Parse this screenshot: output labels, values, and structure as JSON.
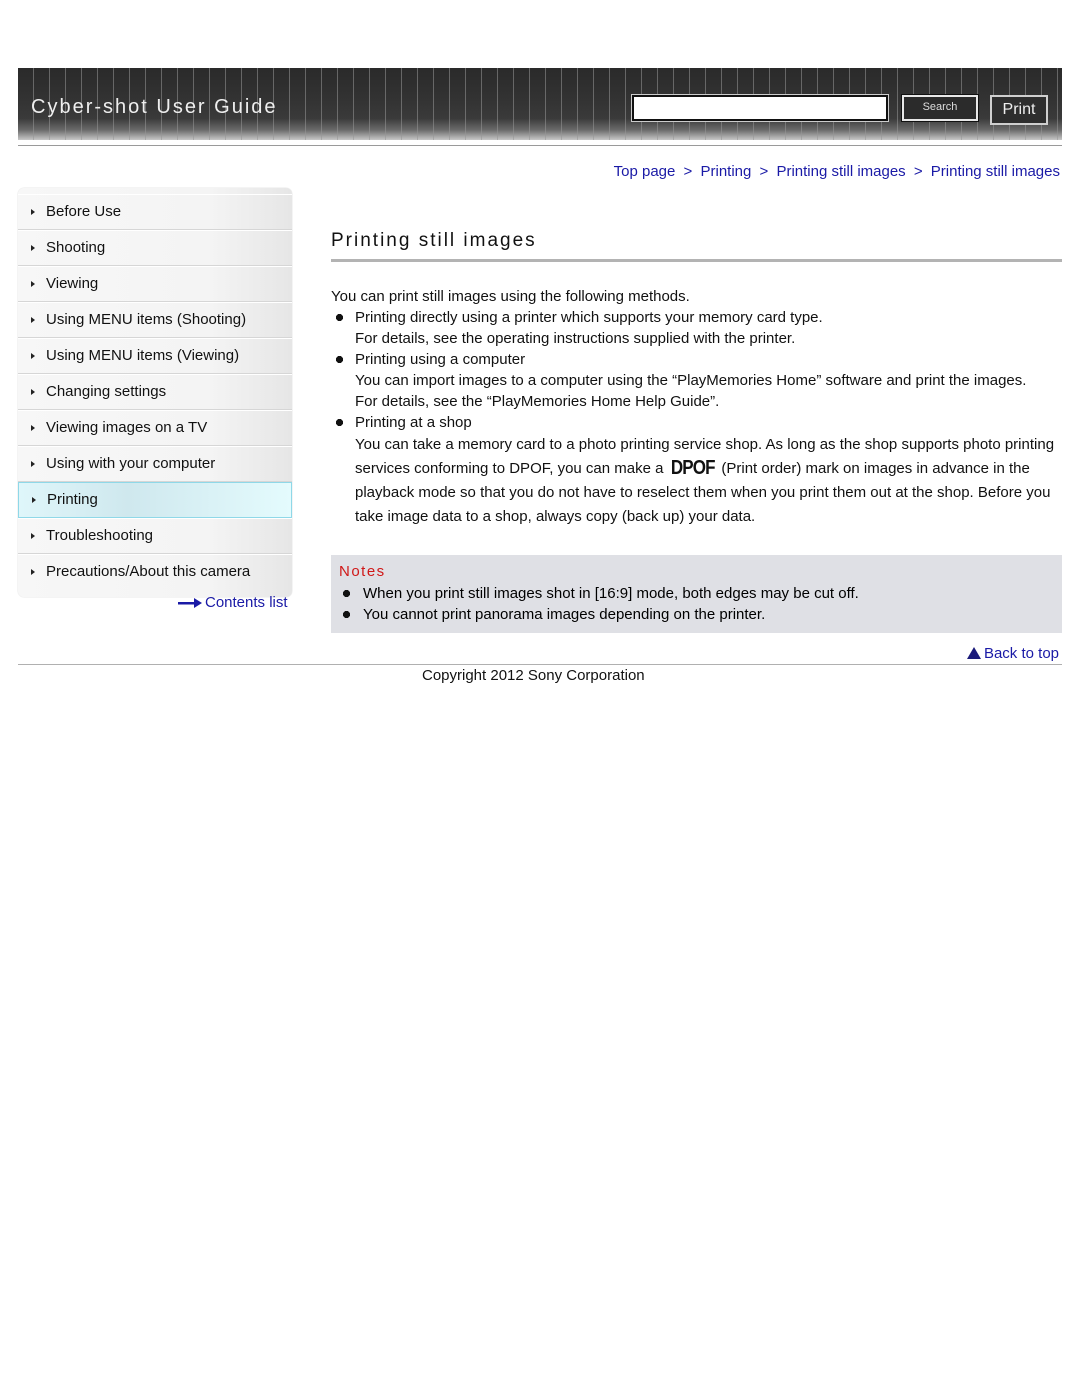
{
  "header": {
    "title": "Cyber-shot User Guide",
    "search": {
      "value": "",
      "placeholder": ""
    },
    "search_button": "Search",
    "print_button": "Print"
  },
  "breadcrumb": [
    {
      "label": "Top page"
    },
    {
      "label": "Printing"
    },
    {
      "label": "Printing still images"
    },
    {
      "label": "Printing still images"
    }
  ],
  "breadcrumb_separator": ">",
  "sidebar": {
    "items": [
      {
        "label": "Before Use",
        "active": false
      },
      {
        "label": "Shooting",
        "active": false
      },
      {
        "label": "Viewing",
        "active": false
      },
      {
        "label": "Using MENU items (Shooting)",
        "active": false
      },
      {
        "label": "Using MENU items (Viewing)",
        "active": false
      },
      {
        "label": "Changing settings",
        "active": false
      },
      {
        "label": "Viewing images on a TV",
        "active": false
      },
      {
        "label": "Using with your computer",
        "active": false
      },
      {
        "label": "Printing",
        "active": true
      },
      {
        "label": "Troubleshooting",
        "active": false
      },
      {
        "label": "Precautions/About this camera",
        "active": false
      }
    ],
    "contents_link": "Contents list",
    "accent_color": "#8fd8e8"
  },
  "main": {
    "title": "Printing still images",
    "intro": "You can print still images using the following methods.",
    "methods": [
      {
        "title": "Printing directly using a printer which supports your memory card type.",
        "lines": [
          "For details, see the operating instructions supplied with the printer."
        ]
      },
      {
        "title": "Printing using a computer",
        "lines": [
          "You can import images to a computer using the “PlayMemories Home” software and print the images.",
          "For details, see the “PlayMemories Home Help Guide”."
        ]
      },
      {
        "title": "Printing at a shop",
        "text_before_icon": "You can take a memory card to a photo printing service shop. As long as the shop supports photo printing services conforming to DPOF, you can make a ",
        "icon_label": "DPOF",
        "text_after_icon": " (Print order) mark on images in advance in the playback mode so that you do not have to reselect them when you print them out at the shop. Before you take image data to a shop, always copy (back up) your data."
      }
    ],
    "notes": {
      "title": "Notes",
      "title_color": "#d01818",
      "items": [
        "When you print still images shot in [16:9] mode, both edges may be cut off.",
        "You cannot print panorama images depending on the printer."
      ]
    },
    "back_to_top": "Back to top"
  },
  "footer": {
    "copyright": "Copyright 2012 Sony Corporation"
  },
  "colors": {
    "link": "#1a1aa6",
    "notes_bg": "#dfe0e5"
  }
}
